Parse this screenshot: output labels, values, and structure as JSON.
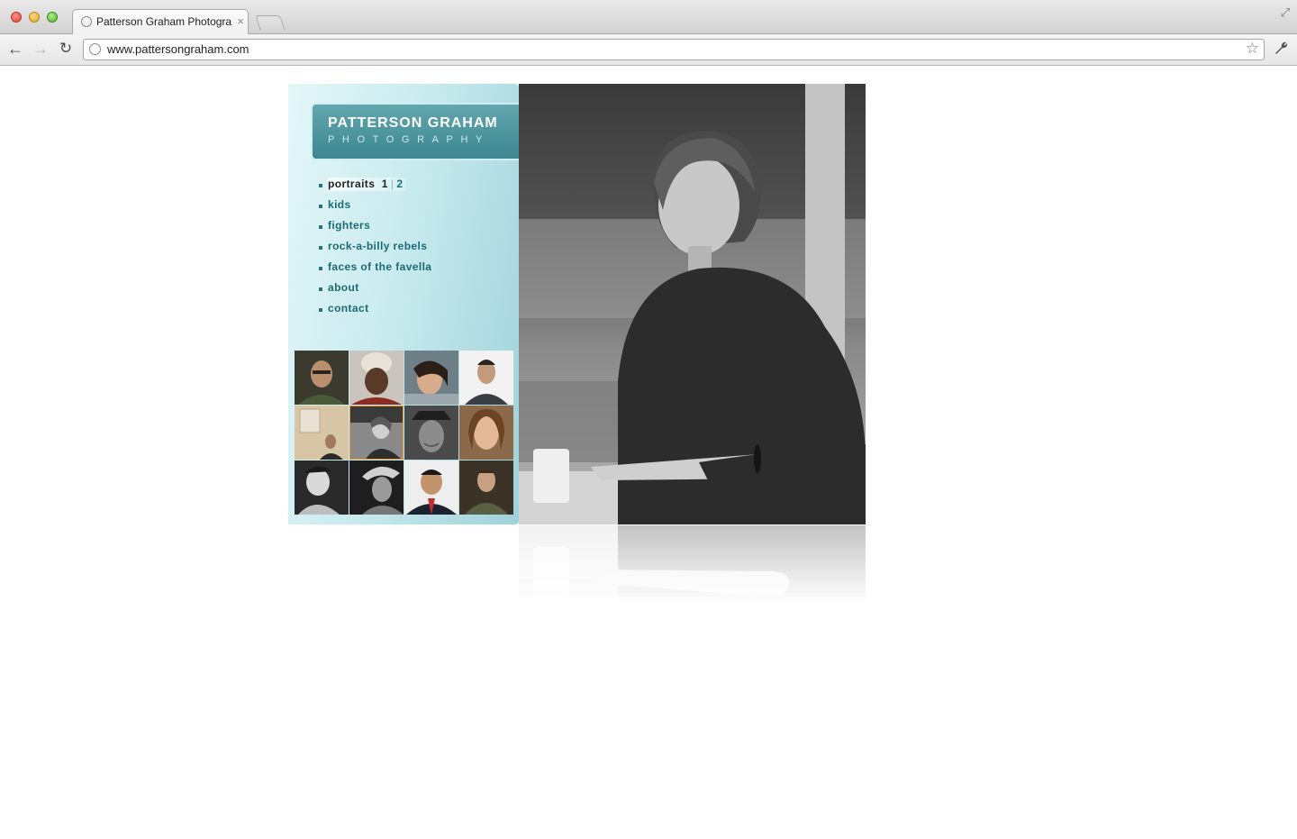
{
  "browser": {
    "tab_title": "Patterson Graham Photograp",
    "tab_close": "×",
    "url": "www.pattersongraham.com",
    "back_icon": "←",
    "forward_icon": "→",
    "reload_icon": "↻",
    "star_icon": "☆",
    "wrench_icon": "🔧",
    "fullscreen_icon": "⤢"
  },
  "logo": {
    "title": "PATTERSON GRAHAM",
    "subtitle": "PHOTOGRAPHY"
  },
  "menu": {
    "items": [
      {
        "label": "portraits",
        "active": true
      },
      {
        "label": "kids"
      },
      {
        "label": "fighters"
      },
      {
        "label": "rock-a-billy rebels"
      },
      {
        "label": "faces of the favella"
      },
      {
        "label": "about"
      },
      {
        "label": "contact"
      }
    ],
    "pages": {
      "current": "1",
      "separator": "|",
      "next": "2"
    }
  },
  "colors": {
    "panel": "#c9ebef",
    "logo_bg": "#3c8690",
    "menu_text": "#1a6a74",
    "thumb_selected_border": "#e39a3a"
  },
  "thumbnails": {
    "count": 12,
    "selected_index": 5
  }
}
